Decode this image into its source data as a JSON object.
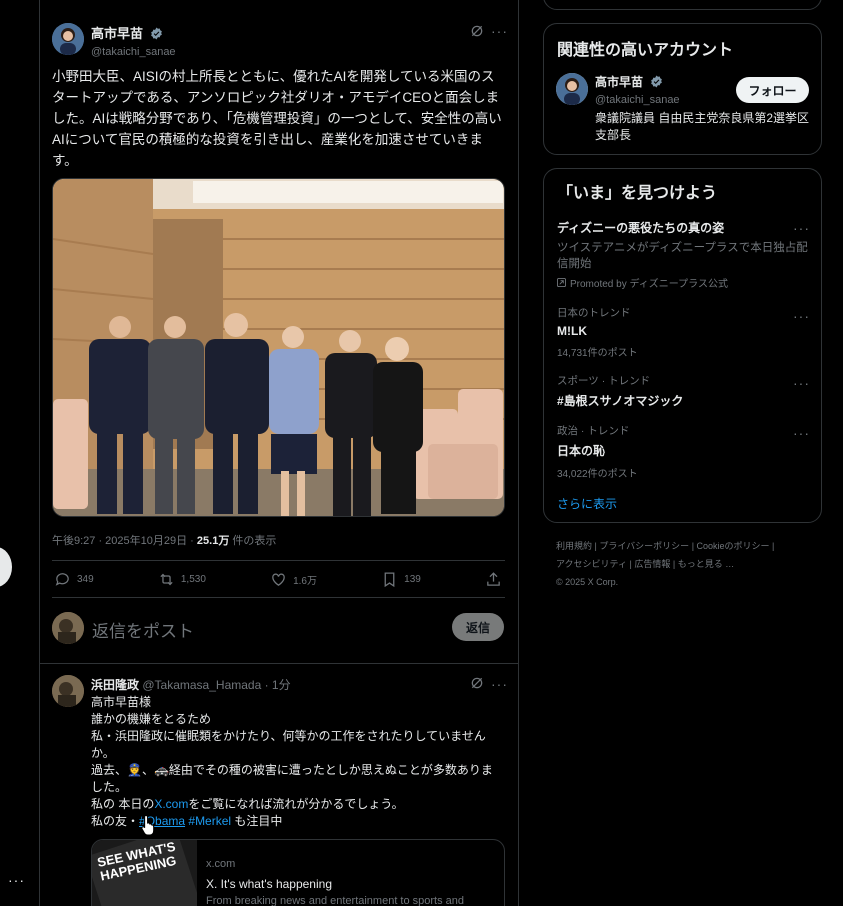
{
  "post": {
    "author_name": "高市早苗",
    "author_handle": "@takaichi_sanae",
    "text": "小野田大臣、AISIの村上所長とともに、優れたAIを開発している米国のスタートアップである、アンソロピック社ダリオ・アモデイCEOと面会しました。AIは戦略分野であり、「危機管理投資」の一つとして、安全性の高いAIについて官民の積極的な投資を引き出し、産業化を加速させていきます。",
    "time": "午後9:27 · 2025年10月29日 · ",
    "views_count": "25.1万",
    "views_label": " 件の表示",
    "replies": "349",
    "reposts": "1,530",
    "likes": "1.6万",
    "bookmarks": "139"
  },
  "reply_box": {
    "placeholder": "返信をポスト",
    "button": "返信"
  },
  "reply": {
    "author_name": "浜田隆政",
    "author_handle": "@Takamasa_Hamada",
    "time": " · 1分",
    "line1": "高市早苗様",
    "line2": "誰かの機嫌をとるため",
    "line3": "私・浜田隆政に催眠類をかけたり、何等かの工作をされたりしていませんか。",
    "line4": "過去、👮、🚓経由でその種の被害に遭ったとしか思えぬことが多数ありました。",
    "line5_pre": "私の 本日の",
    "line5_link": "X.com",
    "line5_post": "をご覧になれば流れが分かるでしょう。",
    "line6_pre": "私の友・",
    "line6_tag1": "#Obama",
    "line6_tag2": "#Merkel",
    "line6_post": " も注目中",
    "card_domain": "x.com",
    "card_title": "X. It's what's happening",
    "card_desc": "From breaking news and entertainment to sports and",
    "card_image_text": "SEE WHAT'S HAPPENING"
  },
  "relevant": {
    "heading": "関連性の高いアカウント",
    "name": "高市早苗",
    "handle": "@takaichi_sanae",
    "follow": "フォロー",
    "bio": "衆議院議員 自由民主党奈良県第2選挙区支部長"
  },
  "trends": {
    "heading": "「いま」を見つけよう",
    "items": [
      {
        "title": "ディズニーの悪役たちの真の姿",
        "desc": "ツイステアニメがディズニープラスで本日独占配信開始",
        "promo": "Promoted by ディズニープラス公式"
      },
      {
        "context": "日本のトレンド",
        "title": "M!LK",
        "posts": "14,731件のポスト"
      },
      {
        "context": "スポーツ · トレンド",
        "title": "#島根スサノオマジック"
      },
      {
        "context": "政治 · トレンド",
        "title": "日本の恥",
        "posts": "34,022件のポスト"
      }
    ],
    "show_more": "さらに表示"
  },
  "footer": {
    "terms": "利用規約",
    "privacy": "プライバシーポリシー",
    "cookies": "Cookieのポリシー",
    "accessibility": "アクセシビリティ",
    "ads": "広告情報",
    "more": "もっと見る …",
    "copyright": "© 2025 X Corp."
  },
  "icons": [
    "verified-icon",
    "grok-icon",
    "more-icon",
    "reply-icon",
    "repost-icon",
    "like-icon",
    "bookmark-icon",
    "share-icon",
    "promoted-icon"
  ],
  "colors": {
    "background": "#000000",
    "accent": "#1d9bf0",
    "border": "#2f3336",
    "muted": "#71767b"
  }
}
